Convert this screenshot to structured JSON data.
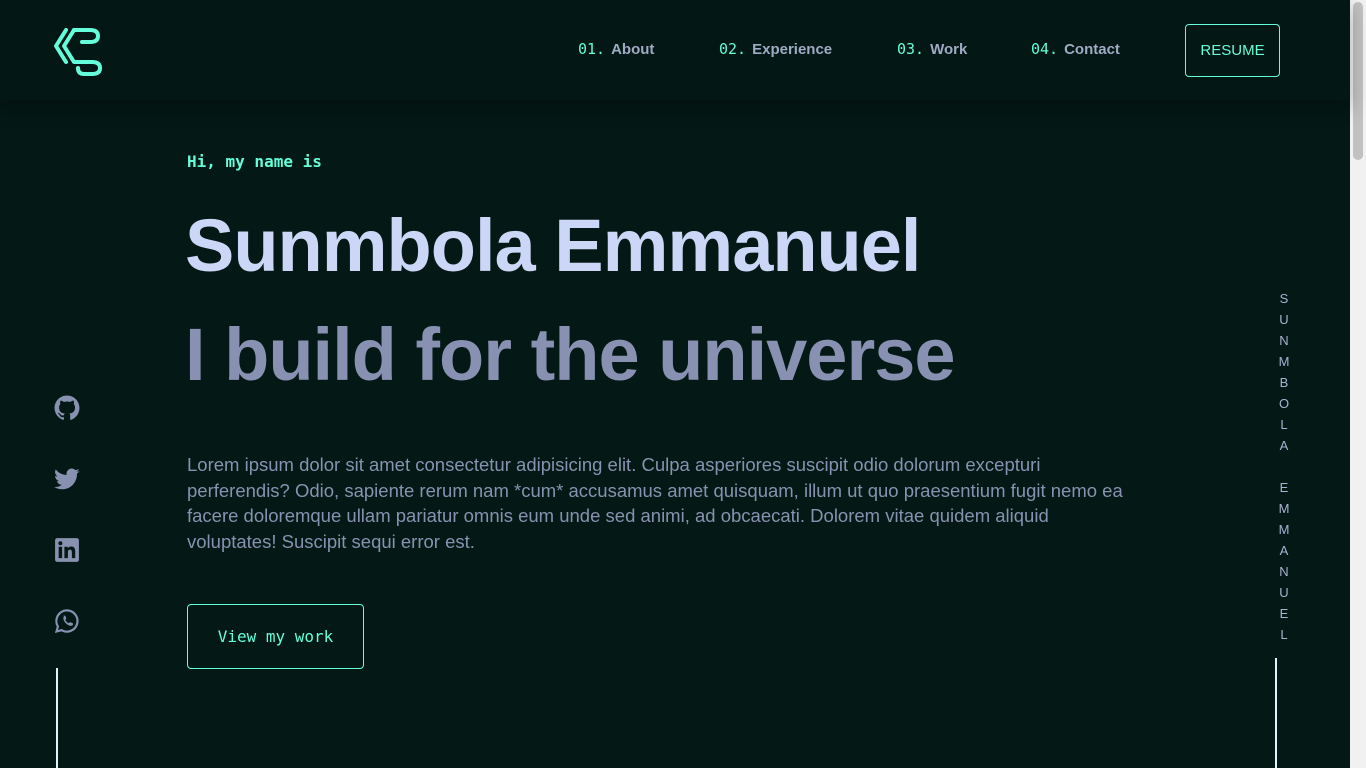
{
  "header": {
    "nav": [
      {
        "num": "01.",
        "label": "About"
      },
      {
        "num": "02.",
        "label": "Experience"
      },
      {
        "num": "03.",
        "label": "Work"
      },
      {
        "num": "04.",
        "label": "Contact"
      }
    ],
    "resume_label": "RESUME",
    "logo_icon": "logo-icon"
  },
  "hero": {
    "greeting": "Hi, my name is",
    "name": "Sunmbola Emmanuel",
    "tagline": "I build for the universe",
    "bio": "Lorem ipsum dolor sit amet consectetur adipisicing elit. Culpa asperiores suscipit odio dolorum excepturi perferendis? Odio, sapiente rerum nam *cum* accusamus amet quisquam, illum ut quo praesentium fugit nemo ea facere doloremque ullam pariatur omnis eum unde sed animi, ad obcaecati. Dolorem vitae quidem aliquid voluptates! Suscipit sequi error est.",
    "cta_label": "View my work"
  },
  "socials": [
    {
      "icon": "github-icon"
    },
    {
      "icon": "twitter-icon"
    },
    {
      "icon": "linkedin-icon"
    },
    {
      "icon": "whatsapp-icon"
    }
  ],
  "side_name": [
    "S",
    "U",
    "N",
    "M",
    "B",
    "O",
    "L",
    "A",
    " ",
    "E",
    "M",
    "M",
    "A",
    "N",
    "U",
    "E",
    "L"
  ],
  "colors": {
    "background": "#041815",
    "accent": "#64ffda",
    "heading": "#ccd6f6",
    "subheading": "#8891b2",
    "text": "#8892b0"
  }
}
